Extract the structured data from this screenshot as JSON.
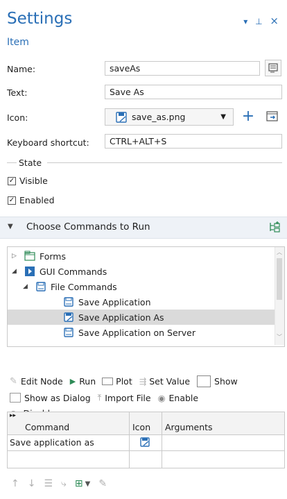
{
  "header": {
    "title": "Settings",
    "subtitle": "Item",
    "controls": {
      "dropdown": "▾",
      "pin": "⊥",
      "close": "×"
    }
  },
  "form": {
    "name_label": "Name:",
    "name_value": "saveAs",
    "text_label": "Text:",
    "text_value": "Save As",
    "icon_label": "Icon:",
    "icon_value": "save_as.png",
    "shortcut_label": "Keyboard shortcut:",
    "shortcut_value": "CTRL+ALT+S"
  },
  "state": {
    "group_label": "State",
    "visible_label": "Visible",
    "visible_checked": true,
    "enabled_label": "Enabled",
    "enabled_checked": true
  },
  "commands_section": {
    "title": "Choose Commands to Run"
  },
  "tree": {
    "items": [
      {
        "label": "Forms",
        "expander": "▷",
        "icon": "forms-icon",
        "level": 0
      },
      {
        "label": "GUI Commands",
        "expander": "◢",
        "icon": "gui-commands-icon",
        "level": 0
      },
      {
        "label": "File Commands",
        "expander": "◢",
        "icon": "file-commands-icon",
        "level": 1
      },
      {
        "label": "Save Application",
        "expander": "",
        "icon": "save-icon",
        "level": 2
      },
      {
        "label": "Save Application As",
        "expander": "",
        "icon": "save-as-icon",
        "level": 2,
        "selected": true
      },
      {
        "label": "Save Application on Server",
        "expander": "",
        "icon": "save-server-icon",
        "level": 2
      }
    ]
  },
  "toolbar": {
    "edit_node": "Edit Node",
    "run": "Run",
    "plot": "Plot",
    "set_value": "Set Value",
    "show": "Show",
    "show_as_dialog": "Show as Dialog",
    "import_file": "Import File",
    "enable": "Enable",
    "disable": "Disable"
  },
  "grid": {
    "headers": {
      "command": "Command",
      "icon": "Icon",
      "arguments": "Arguments"
    },
    "rows": [
      {
        "command": "Save application as",
        "icon": "save-as-icon",
        "arguments": ""
      }
    ]
  },
  "colors": {
    "accent": "#2a6fb6",
    "green": "#2e8b57",
    "selected_row": "#dadada",
    "section_bg": "#eef2f7"
  }
}
